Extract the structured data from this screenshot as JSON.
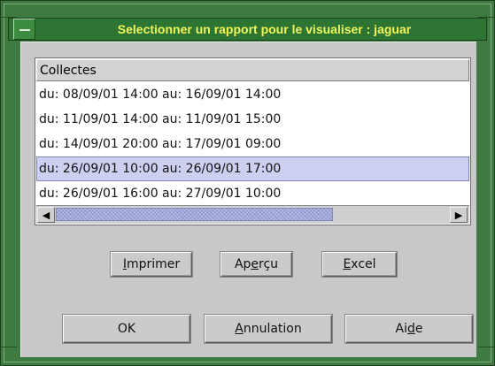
{
  "window": {
    "title": "Selectionner un rapport pour le visualiser : jaguar",
    "title_color": "#f0f75c",
    "frame_color": "#3f7a41"
  },
  "list": {
    "column_header": "Collectes",
    "rows": [
      "du: 08/09/01 14:00 au: 16/09/01 14:00",
      "du: 11/09/01 14:00 au: 11/09/01 15:00",
      "du: 14/09/01 20:00 au: 17/09/01 09:00",
      "du: 26/09/01 10:00 au: 26/09/01 17:00",
      "du: 26/09/01 16:00 au: 27/09/01 10:00"
    ],
    "selected_index": 3,
    "selection_color": "#cdd0f0",
    "scroll_left_icon": "arrow-left-icon",
    "scroll_right_icon": "arrow-right-icon"
  },
  "buttons": {
    "imprimer": {
      "pre": "",
      "mn": "I",
      "post": "mprimer"
    },
    "apercu": {
      "pre": "Ap",
      "mn": "e",
      "post": "rçu"
    },
    "excel": {
      "pre": "",
      "mn": "E",
      "post": "xcel"
    },
    "ok": {
      "pre": "OK",
      "mn": "",
      "post": ""
    },
    "annulation": {
      "pre": "",
      "mn": "A",
      "post": "nnulation"
    },
    "aide": {
      "pre": "Ai",
      "mn": "d",
      "post": "e"
    }
  }
}
